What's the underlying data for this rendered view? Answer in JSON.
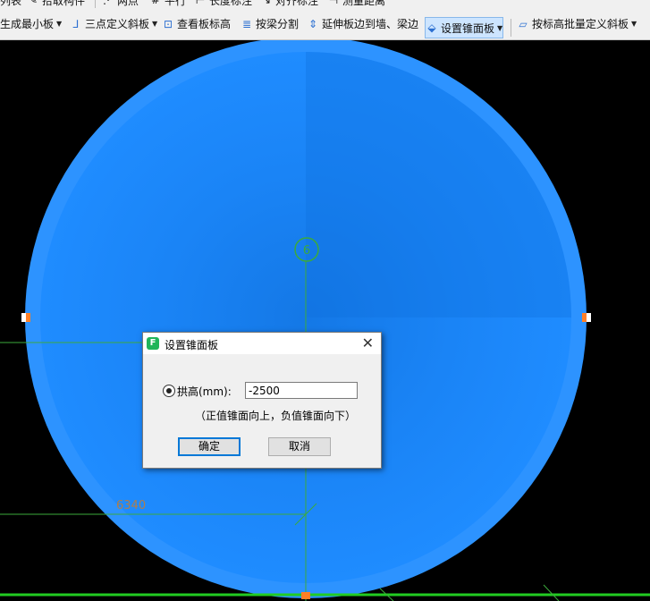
{
  "toolbar_top": {
    "items": [
      {
        "label": "列表",
        "icon": "list-icon"
      },
      {
        "label": "拾取构件",
        "icon": "pick-icon"
      },
      {
        "label": "两点",
        "icon": "two-point-icon"
      },
      {
        "label": "平行",
        "icon": "parallel-icon"
      },
      {
        "label": "长度标注",
        "icon": "length-dim-icon"
      },
      {
        "label": "对齐标注",
        "icon": "align-dim-icon"
      },
      {
        "label": "测量距离",
        "icon": "measure-icon"
      }
    ]
  },
  "toolbar_main": {
    "items": [
      {
        "label": "生成最小板",
        "icon": "",
        "dropdown": true
      },
      {
        "label": "三点定义斜板",
        "icon": "three-point-slope-icon",
        "dropdown": true
      },
      {
        "label": "查看板标高",
        "icon": "view-elevation-icon"
      },
      {
        "label": "按梁分割",
        "icon": "split-by-beam-icon"
      },
      {
        "label": "延伸板边到墙、梁边",
        "icon": "extend-edge-icon"
      },
      {
        "label": "设置锥面板",
        "icon": "cone-slab-icon",
        "dropdown": true,
        "active": true
      },
      {
        "label": "按标高批量定义斜板",
        "icon": "batch-slope-icon",
        "dropdown": true
      }
    ]
  },
  "canvas": {
    "circle_label": "6",
    "dimension_text": "6340",
    "colors": {
      "slab": "#1a8cff",
      "slab_rim": "#2d93ff",
      "axis": "#3caa3c",
      "dim": "#b07e4a",
      "grip": "#ff7f27"
    }
  },
  "dialog": {
    "title": "设置锥面板",
    "icon_letter": "F",
    "rise_label": "拱高(mm):",
    "rise_value": "-2500",
    "hint": "（正值锥面向上，负值锥面向下）",
    "ok_label": "确定",
    "cancel_label": "取消"
  }
}
